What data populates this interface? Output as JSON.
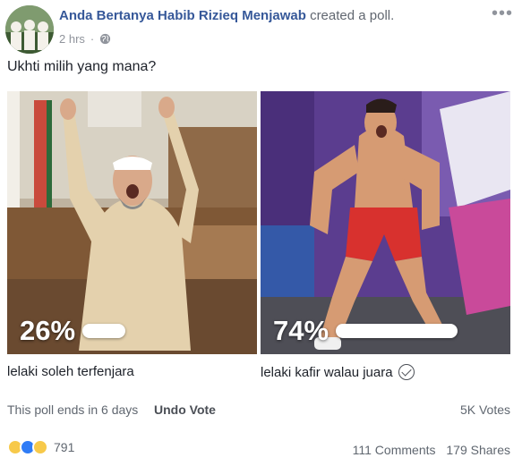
{
  "post": {
    "author": "Anda Bertanya Habib Rizieq Menjawab",
    "action": "created a poll.",
    "time": "2 hrs",
    "text": "Ukhti milih yang mana?"
  },
  "poll": {
    "options": [
      {
        "label": "lelaki soleh terfenjara",
        "percent_label": "26%",
        "percent": 26,
        "selected": false
      },
      {
        "label": "lelaki kafir walau juara",
        "percent_label": "74%",
        "percent": 74,
        "selected": true
      }
    ],
    "ends_text": "This poll ends in 6 days",
    "undo_label": "Undo Vote",
    "votes_text": "5K Votes"
  },
  "engagement": {
    "reaction_count": "791",
    "comments": "111 Comments",
    "shares": "179 Shares"
  },
  "icons": {
    "more": "more-options-icon",
    "privacy": "globe-icon",
    "selected": "check-circle-icon"
  },
  "colors": {
    "author": "#365899",
    "muted": "#90949c",
    "like": "#2f7cf6",
    "haha": "#f7c94a"
  }
}
